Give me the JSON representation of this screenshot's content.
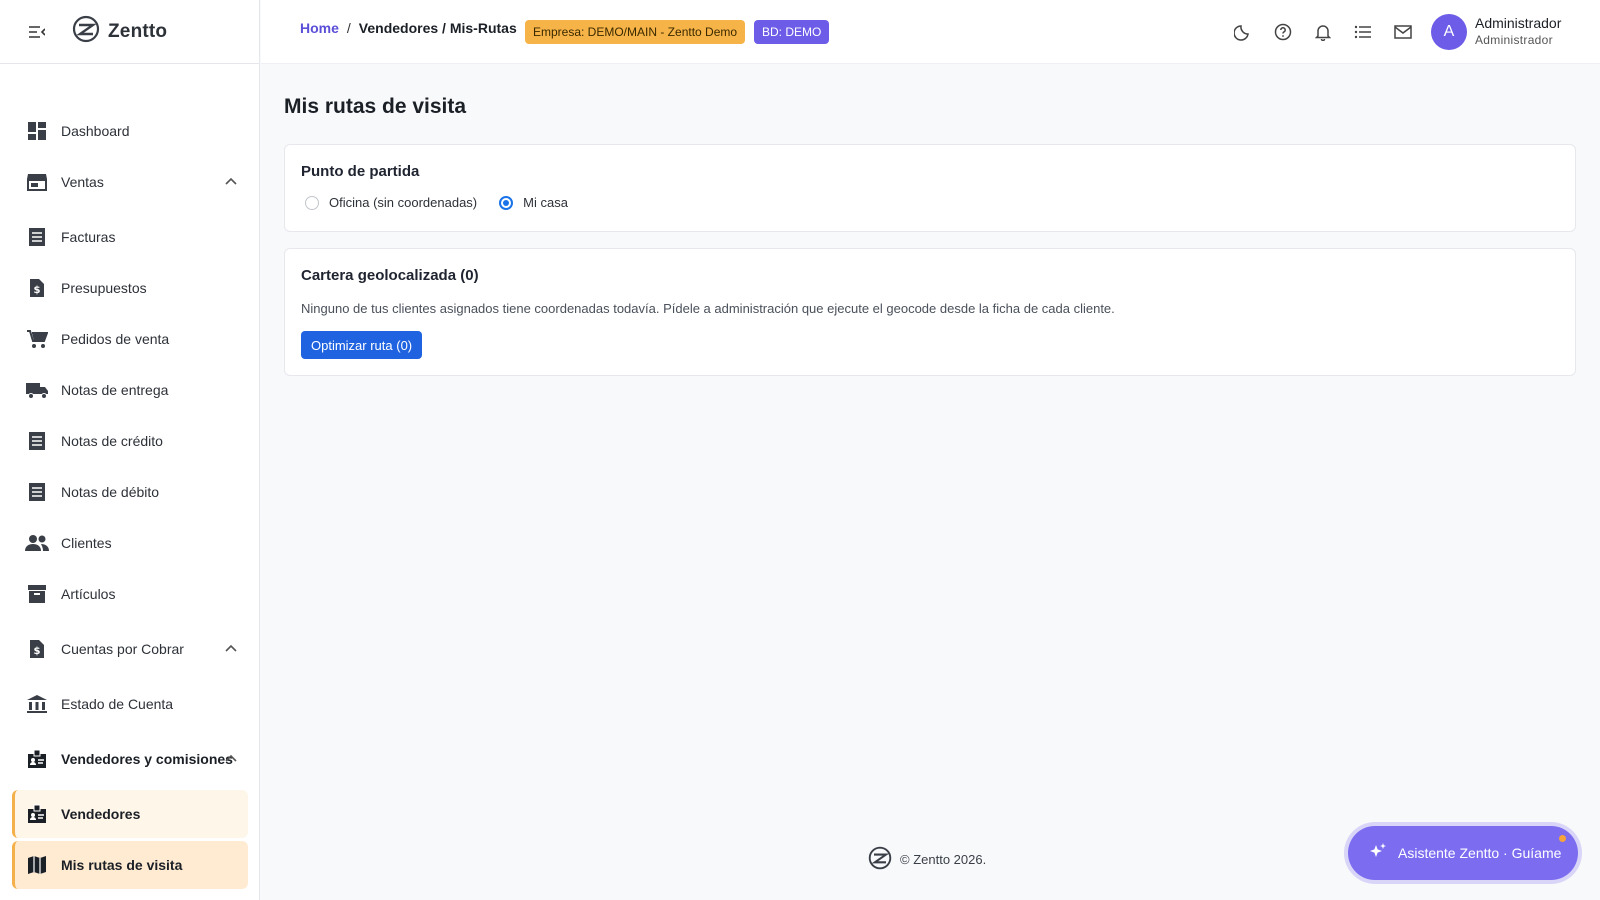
{
  "app": {
    "brand": "Zentto"
  },
  "sidebar": {
    "items": [
      {
        "label": "Dashboard",
        "icon": "dashboard-icon"
      },
      {
        "label": "Ventas",
        "icon": "store-icon",
        "expanded": true
      },
      {
        "label": "Facturas",
        "icon": "receipt-icon"
      },
      {
        "label": "Presupuestos",
        "icon": "request-quote-icon"
      },
      {
        "label": "Pedidos de venta",
        "icon": "shopping-cart-icon"
      },
      {
        "label": "Notas de entrega",
        "icon": "truck-icon"
      },
      {
        "label": "Notas de crédito",
        "icon": "receipt-icon"
      },
      {
        "label": "Notas de débito",
        "icon": "receipt-icon"
      },
      {
        "label": "Clientes",
        "icon": "people-icon"
      },
      {
        "label": "Artículos",
        "icon": "inventory-box-icon"
      },
      {
        "label": "Cuentas por Cobrar",
        "icon": "request-quote-icon",
        "expanded": true
      },
      {
        "label": "Estado de Cuenta",
        "icon": "bank-icon"
      },
      {
        "label": "Vendedores y comisiones",
        "icon": "badge-icon",
        "expanded": true
      },
      {
        "label": "Vendedores",
        "icon": "badge-icon",
        "selected": true
      },
      {
        "label": "Mis rutas de visita",
        "icon": "map-icon",
        "selected": true
      }
    ]
  },
  "header": {
    "breadcrumb": {
      "home": "Home",
      "separator": "/",
      "current": "Vendedores / Mis-Rutas"
    },
    "company_badge": "Empresa: DEMO/MAIN - Zentto Demo",
    "db_badge": "BD: DEMO",
    "user": {
      "initial": "A",
      "name": "Administrador",
      "role": "Administrador"
    }
  },
  "main": {
    "title": "Mis rutas de visita",
    "start_point": {
      "title": "Punto de partida",
      "options": [
        {
          "label": "Oficina (sin coordenadas)",
          "checked": false
        },
        {
          "label": "Mi casa",
          "checked": true
        }
      ]
    },
    "portfolio": {
      "title": "Cartera geolocalizada (0)",
      "message": "Ninguno de tus clientes asignados tiene coordenadas todavía. Pídele a administración que ejecute el geocode desde la ficha de cada cliente.",
      "button": "Optimizar ruta (0)"
    }
  },
  "footer": {
    "text": "© Zentto 2026."
  },
  "assistant": {
    "label": "Asistente Zentto · Guíame"
  },
  "colors": {
    "accent": "#6c5ce7",
    "primary_button": "#1f63e0",
    "warning_badge": "#f6b347",
    "selected_item": "#ffebd2"
  }
}
